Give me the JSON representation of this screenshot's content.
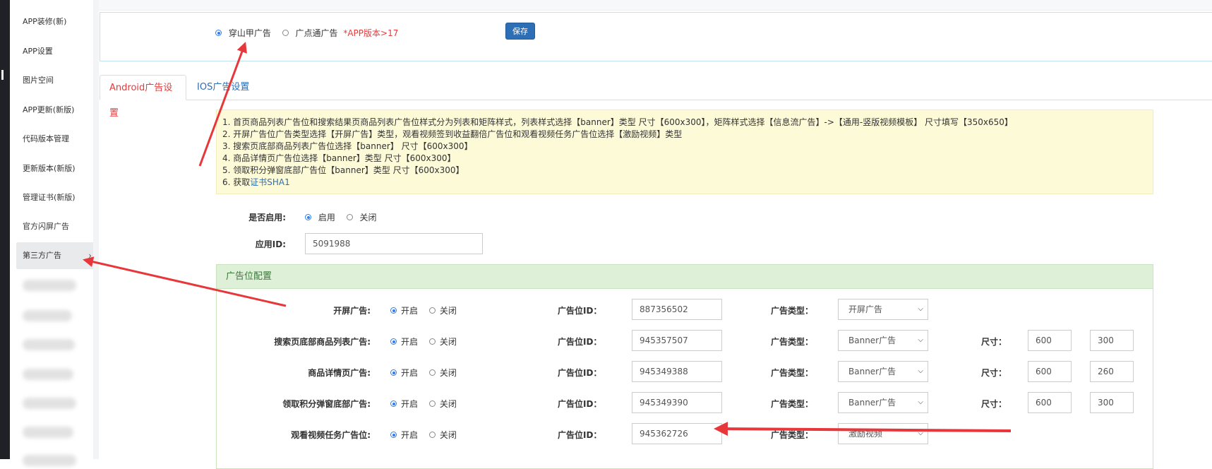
{
  "sidebar": {
    "items": [
      {
        "label": "APP装修(新)"
      },
      {
        "label": "APP设置"
      },
      {
        "label": "图片空间"
      },
      {
        "label": "APP更新(新版)"
      },
      {
        "label": "代码版本管理"
      },
      {
        "label": "更新版本(新版)"
      },
      {
        "label": "管理证书(新版)"
      },
      {
        "label": "官方闪屏广告"
      },
      {
        "label": "第三方广告",
        "chevron": "›"
      }
    ]
  },
  "provider": {
    "option1": "穿山甲广告",
    "option2": "广点通广告",
    "option2_note": "*APP版本>17",
    "selected": "穿山甲广告",
    "save_label": "保存"
  },
  "tabs": [
    {
      "label": "Android广告设置",
      "active": true
    },
    {
      "label": "IOS广告设置",
      "active": false
    }
  ],
  "notes": [
    "1. 首页商品列表广告位和搜索结果页商品列表广告位样式分为列表和矩阵样式，列表样式选择【banner】类型 尺寸【600x300】，矩阵样式选择【信息流广告】->【通用-竖版视频模板】 尺寸填写【350x650】",
    "2. 开屏广告位广告类型选择【开屏广告】类型，观看视频签到收益翻倍广告位和观看视频任务广告位选择【激励视频】类型",
    "3. 搜索页底部商品列表广告位选择【banner】 尺寸【600x300】",
    "4. 商品详情页广告位选择【banner】类型 尺寸【600x300】",
    "5. 领取积分弹窗底部广告位【banner】类型 尺寸【600x300】"
  ],
  "note6": {
    "prefix": "6. 获取",
    "link": "证书SHA1"
  },
  "enable": {
    "label": "是否启用:",
    "on": "启用",
    "off": "关闭"
  },
  "app_id": {
    "label": "应用ID:",
    "value": "5091988"
  },
  "panel": {
    "title": "广告位配置",
    "labels": {
      "on": "开启",
      "off": "关闭",
      "slot_id": "广告位ID：",
      "ad_type": "广告类型：",
      "size": "尺寸："
    },
    "rows": [
      {
        "name": "开屏广告:",
        "slot_id": "887356502",
        "type": "开屏广告"
      },
      {
        "name": "搜索页底部商品列表广告:",
        "slot_id": "945357507",
        "type": "Banner广告",
        "w": "600",
        "h": "300"
      },
      {
        "name": "商品详情页广告:",
        "slot_id": "945349388",
        "type": "Banner广告",
        "w": "600",
        "h": "260"
      },
      {
        "name": "领取积分弹窗底部广告:",
        "slot_id": "945349390",
        "type": "Banner广告",
        "w": "600",
        "h": "300"
      },
      {
        "name": "观看视频任务广告位:",
        "slot_id": "945362726",
        "type": "激励视频"
      }
    ]
  },
  "colors": {
    "accent": "#2e7cf6",
    "annotation": "#e8373b",
    "panel_head": "#dff0d8",
    "notes_bg": "#fdfad7"
  }
}
